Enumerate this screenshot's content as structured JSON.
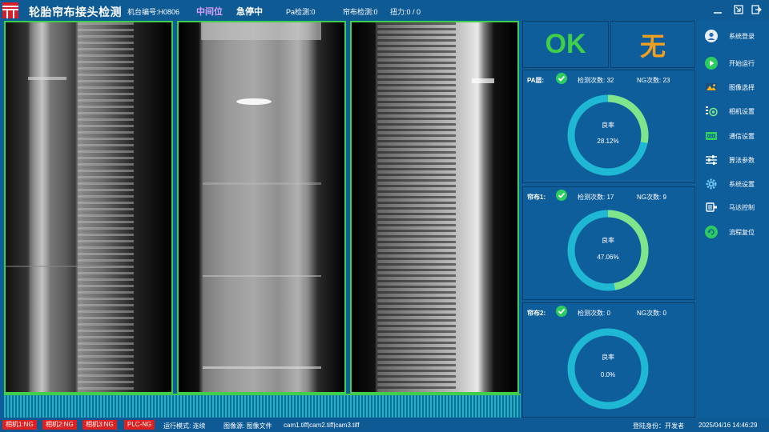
{
  "header": {
    "title": "轮胎帘布接头检测",
    "machine_no": "机台编号:H0806",
    "position": "中间位",
    "estop": "急停中",
    "pa_detect": "Pa检测:0",
    "cord_detect": "帘布检测:0",
    "twist_force": "扭力:0 / 0"
  },
  "colors": {
    "ok": "#3fcf4a",
    "none": "#f0a020",
    "position": "#d6a0ff",
    "ring_track": "#1fb8d4",
    "ring_fill": "#7fe48a",
    "ng": "#e02020"
  },
  "result": {
    "ok_label": "OK",
    "none_label": "无"
  },
  "stats": [
    {
      "label": "PA层:",
      "detect": "检测次数: 32",
      "ng": "NG次数: 23",
      "rate_label": "良率",
      "rate_text": "28.12%",
      "rate": 0.2812
    },
    {
      "label": "帘布1:",
      "detect": "检测次数: 17",
      "ng": "NG次数: 9",
      "rate_label": "良率",
      "rate_text": "47.06%",
      "rate": 0.4706
    },
    {
      "label": "帘布2:",
      "detect": "检测次数: 0",
      "ng": "NG次数: 0",
      "rate_label": "良率",
      "rate_text": "0.0%",
      "rate": 0.0
    }
  ],
  "nav": [
    {
      "label": "系统登录",
      "icon": "user-icon"
    },
    {
      "label": "开始运行",
      "icon": "play-icon"
    },
    {
      "label": "图像选择",
      "icon": "image-icon"
    },
    {
      "label": "相机设置",
      "icon": "camera-icon"
    },
    {
      "label": "通信设置",
      "icon": "network-icon"
    },
    {
      "label": "算法参数",
      "icon": "sliders-icon"
    },
    {
      "label": "系统设置",
      "icon": "gear-icon"
    },
    {
      "label": "马达控制",
      "icon": "motor-icon"
    },
    {
      "label": "流程复位",
      "icon": "reset-icon"
    }
  ],
  "statusbar": {
    "cam1": "相机1:NG",
    "cam2": "相机2:NG",
    "cam3": "相机3:NG",
    "plc": "PLC-NG",
    "run_mode": "运行模式: 连续",
    "image_source": "图像源: 图像文件",
    "files": "cam1.tiff|cam2.tiff|cam3.tiff",
    "login": "登陆身份：开发者",
    "datetime": "2025/04/16 14:46:29"
  }
}
